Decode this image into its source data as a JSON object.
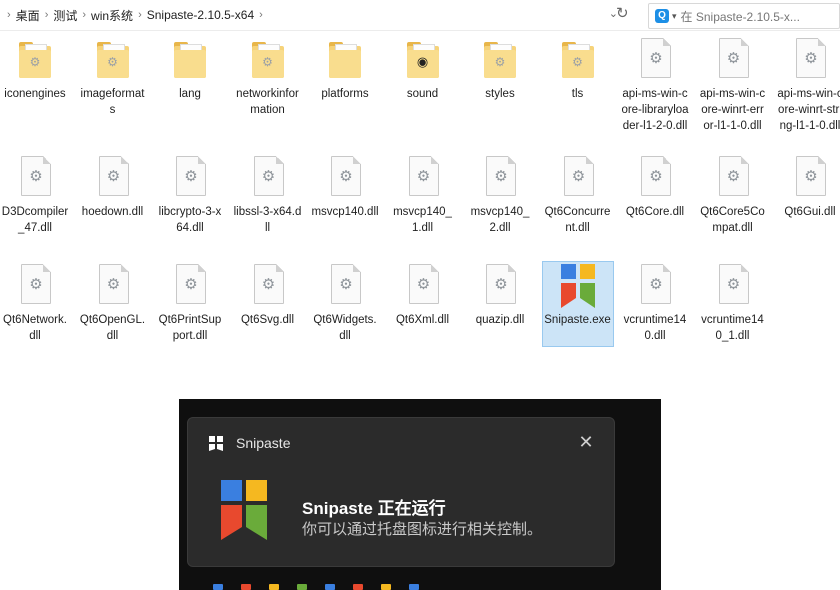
{
  "address": {
    "crumbs": [
      "桌面",
      "测试",
      "win系统",
      "Snipaste-2.10.5-x64"
    ],
    "search_placeholder": "在 Snipaste-2.10.5-x..."
  },
  "files": [
    {
      "name": "iconengines",
      "kind": "folder",
      "glyph": "gear-icon"
    },
    {
      "name": "imageformats",
      "kind": "folder",
      "glyph": "gear-icon"
    },
    {
      "name": "lang",
      "kind": "folder",
      "glyph": "none"
    },
    {
      "name": "networkinformation",
      "kind": "folder",
      "glyph": "gear-icon"
    },
    {
      "name": "platforms",
      "kind": "folder",
      "glyph": "none"
    },
    {
      "name": "sound",
      "kind": "folder",
      "glyph": "speaker-icon"
    },
    {
      "name": "styles",
      "kind": "folder",
      "glyph": "gear-icon"
    },
    {
      "name": "tls",
      "kind": "folder",
      "glyph": "gear-icon"
    },
    {
      "name": "api-ms-win-core-libraryloader-l1-2-0.dll",
      "kind": "file"
    },
    {
      "name": "api-ms-win-core-winrt-error-l1-1-0.dll",
      "kind": "file"
    },
    {
      "name": "api-ms-win-core-winrt-string-l1-1-0.dll",
      "kind": "file"
    },
    {
      "name": "D3Dcompiler_47.dll",
      "kind": "file"
    },
    {
      "name": "hoedown.dll",
      "kind": "file"
    },
    {
      "name": "libcrypto-3-x64.dll",
      "kind": "file"
    },
    {
      "name": "libssl-3-x64.dll",
      "kind": "file"
    },
    {
      "name": "msvcp140.dll",
      "kind": "file"
    },
    {
      "name": "msvcp140_1.dll",
      "kind": "file"
    },
    {
      "name": "msvcp140_2.dll",
      "kind": "file"
    },
    {
      "name": "Qt6Concurrent.dll",
      "kind": "file"
    },
    {
      "name": "Qt6Core.dll",
      "kind": "file"
    },
    {
      "name": "Qt6Core5Compat.dll",
      "kind": "file"
    },
    {
      "name": "Qt6Gui.dll",
      "kind": "file"
    },
    {
      "name": "Qt6Network.dll",
      "kind": "file"
    },
    {
      "name": "Qt6OpenGL.dll",
      "kind": "file"
    },
    {
      "name": "Qt6PrintSupport.dll",
      "kind": "file"
    },
    {
      "name": "Qt6Svg.dll",
      "kind": "file"
    },
    {
      "name": "Qt6Widgets.dll",
      "kind": "file"
    },
    {
      "name": "Qt6Xml.dll",
      "kind": "file"
    },
    {
      "name": "quazip.dll",
      "kind": "file"
    },
    {
      "name": "Snipaste.exe",
      "kind": "exe",
      "selected": true
    },
    {
      "name": "vcruntime140.dll",
      "kind": "file"
    },
    {
      "name": "vcruntime140_1.dll",
      "kind": "file"
    }
  ],
  "notification": {
    "app_name": "Snipaste",
    "title": "Snipaste 正在运行",
    "body": "你可以通过托盘图标进行相关控制。",
    "close_icon": "close-icon"
  },
  "colors": {
    "logo_blue": "#3a7fe0",
    "logo_yellow": "#f5b820",
    "logo_red": "#e8492e",
    "logo_green": "#6aab3a",
    "selection_bg": "#cce4f7",
    "toast_bg": "#2b2b2b"
  }
}
